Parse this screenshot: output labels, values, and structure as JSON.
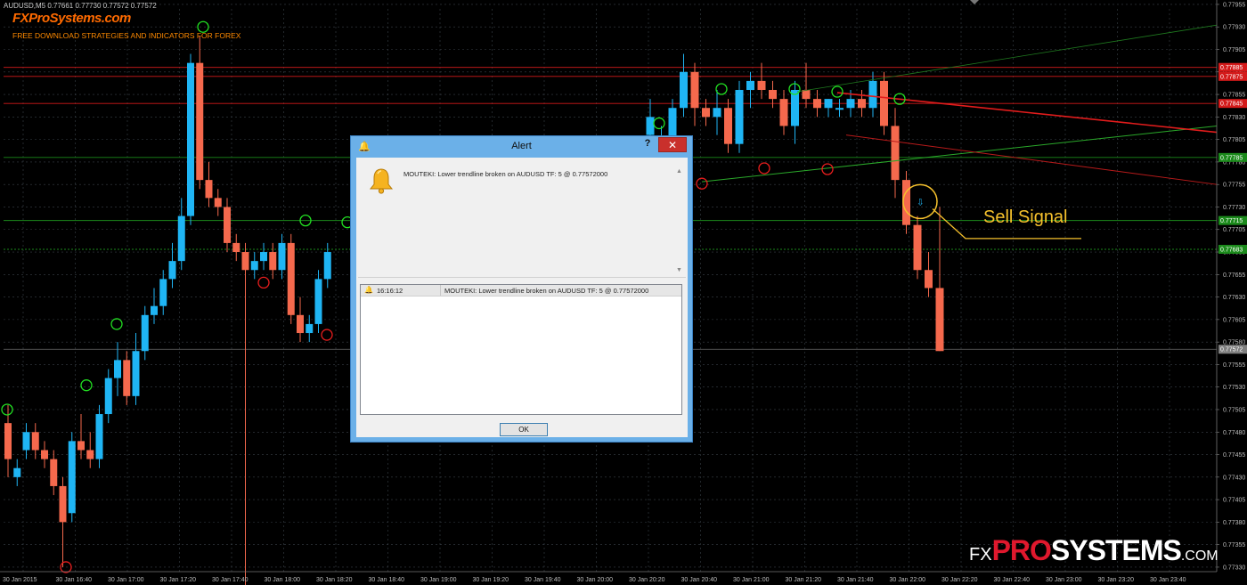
{
  "chart": {
    "symbol_line": "AUDUSD,M5  0.77661 0.77730 0.77572 0.77572",
    "brand_logo": "FXProSystems.com",
    "brand_tagline": "FREE DOWNLOAD STRATEGIES AND INDICATORS FOR FOREX",
    "annotation": "Sell Signal",
    "watermark": {
      "fx": "FX",
      "pro": "PRO",
      "systems": "SYSTEMS",
      "com": ".COM"
    },
    "colors": {
      "background": "#000000",
      "grid": "#3a4148",
      "bull": "#1fb5f4",
      "bear": "#f5694d",
      "resistance": "#d41a1a",
      "support": "#1b8a1b",
      "swing_high": "#22e022",
      "swing_low": "#e81d1d",
      "annotation": "#f6c12c"
    },
    "price_axis": {
      "min": 0.7731,
      "max": 0.77945,
      "ticks": [
        "0.77955",
        "0.77930",
        "0.77905",
        "0.77880",
        "0.77855",
        "0.77830",
        "0.77805",
        "0.77780",
        "0.77755",
        "0.77730",
        "0.77705",
        "0.77680",
        "0.77655",
        "0.77630",
        "0.77605",
        "0.77580",
        "0.77555",
        "0.77530",
        "0.77505",
        "0.77480",
        "0.77455",
        "0.77430",
        "0.77405",
        "0.77380",
        "0.77355",
        "0.77330"
      ],
      "tags": [
        {
          "price": 0.77885,
          "label": "0.77885",
          "color": "#d41a1a"
        },
        {
          "price": 0.77875,
          "label": "0.77875",
          "color": "#d41a1a"
        },
        {
          "price": 0.77845,
          "label": "0.77845",
          "color": "#d41a1a"
        },
        {
          "price": 0.77785,
          "label": "0.77785",
          "color": "#1b8a1b"
        },
        {
          "price": 0.77715,
          "label": "0.77715",
          "color": "#1b8a1b"
        },
        {
          "price": 0.77683,
          "label": "0.77683",
          "color": "#1b8a1b"
        },
        {
          "price": 0.77572,
          "label": "0.77572",
          "color": "#7f7f7f"
        }
      ]
    },
    "time_axis": [
      "30 Jan 2015",
      "30 Jan 16:40",
      "30 Jan 17:00",
      "30 Jan 17:20",
      "30 Jan 17:40",
      "30 Jan 18:00",
      "30 Jan 18:20",
      "30 Jan 18:40",
      "30 Jan 19:00",
      "30 Jan 19:20",
      "30 Jan 19:40",
      "30 Jan 20:00",
      "30 Jan 20:20",
      "30 Jan 20:40",
      "30 Jan 21:00",
      "30 Jan 21:20",
      "30 Jan 21:40",
      "30 Jan 22:00",
      "30 Jan 22:20",
      "30 Jan 22:40",
      "30 Jan 23:00",
      "30 Jan 23:20",
      "30 Jan 23:40"
    ]
  },
  "alert": {
    "title": "Alert",
    "help_label": "?",
    "close_label": "✕",
    "message": "MOUTEKI: Lower trendline broken on AUDUSD TF: 5 @ 0.77572000",
    "log": [
      {
        "time": "16:16:12",
        "message": "MOUTEKI: Lower trendline broken on AUDUSD TF: 5 @ 0.77572000"
      }
    ],
    "ok_label": "OK"
  }
}
